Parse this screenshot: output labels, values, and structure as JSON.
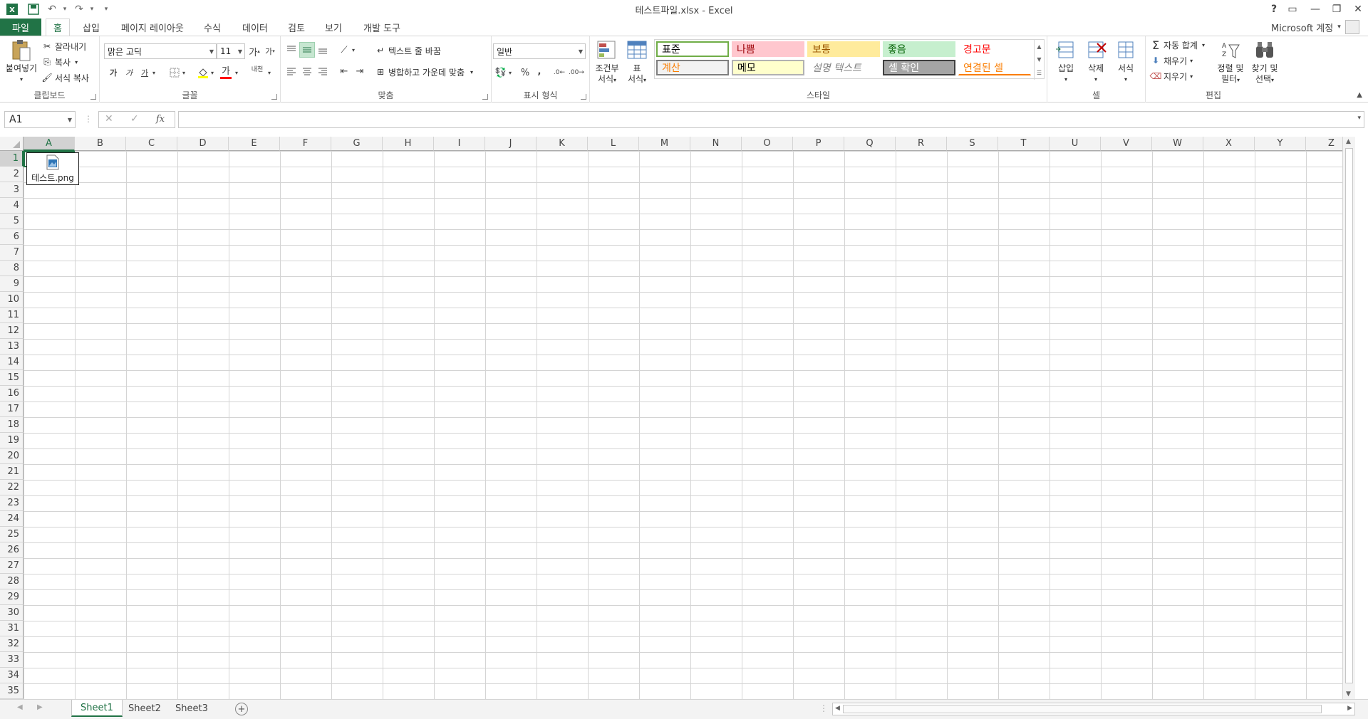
{
  "window": {
    "title": "테스트파일.xlsx - Excel",
    "help": "?",
    "account": "Microsoft 계정"
  },
  "tabs": [
    "파일",
    "홈",
    "삽입",
    "페이지 레이아웃",
    "수식",
    "데이터",
    "검토",
    "보기",
    "개발 도구"
  ],
  "active_tab": "홈",
  "ribbon": {
    "clipboard": {
      "paste": "붙여넣기",
      "cut": "잘라내기",
      "copy": "복사",
      "format_painter": "서식 복사",
      "label": "클립보드"
    },
    "font": {
      "font_name": "맑은 고딕",
      "font_size": "11",
      "grow": "가",
      "shrink": "가",
      "bold": "가",
      "italic": "가",
      "underline": "가",
      "font_color": "가",
      "phonetic": "내천",
      "label": "글꼴"
    },
    "alignment": {
      "wrap_text": "텍스트 줄 바꿈",
      "merge_center": "병합하고 가운데 맞춤",
      "label": "맞춤"
    },
    "number": {
      "format": "일반",
      "percent": "%",
      "comma": ",",
      "label": "표시 형식"
    },
    "styles": {
      "conditional": [
        "조건부",
        "서식"
      ],
      "format_table": [
        "표",
        "서식"
      ],
      "cells": [
        {
          "text": "표준",
          "bg": "#ffffff",
          "fg": "#000000",
          "border": "#70ad47"
        },
        {
          "text": "나쁨",
          "bg": "#ffc7ce",
          "fg": "#9c0006",
          "border": ""
        },
        {
          "text": "보통",
          "bg": "#ffeb9c",
          "fg": "#9c5700",
          "border": ""
        },
        {
          "text": "좋음",
          "bg": "#c6efce",
          "fg": "#006100",
          "border": ""
        },
        {
          "text": "경고문",
          "bg": "#ffffff",
          "fg": "#ff0000",
          "border": ""
        },
        {
          "text": "계산",
          "bg": "#f2f2f2",
          "fg": "#fa7d00",
          "border": "#7f7f7f"
        },
        {
          "text": "메모",
          "bg": "#ffffcc",
          "fg": "#000000",
          "border": "#b2b2b2"
        },
        {
          "text": "설명 텍스트",
          "bg": "#ffffff",
          "fg": "#7f7f7f",
          "border": ""
        },
        {
          "text": "셀 확인",
          "bg": "#a5a5a5",
          "fg": "#ffffff",
          "border": "#3f3f3f"
        },
        {
          "text": "연결된 셀",
          "bg": "#ffffff",
          "fg": "#fa7d00",
          "border": ""
        }
      ],
      "label": "스타일"
    },
    "cells": {
      "insert": "삽입",
      "delete": "삭제",
      "format": "서식",
      "label": "셀"
    },
    "editing": {
      "autosum": "자동 합계",
      "fill": "채우기",
      "clear": "지우기",
      "sort_filter": [
        "정렬 및",
        "필터"
      ],
      "find_select": [
        "찾기 및",
        "선택"
      ],
      "label": "편집"
    }
  },
  "formula_bar": {
    "name_box": "A1",
    "fx": "fx",
    "value": ""
  },
  "grid": {
    "columns": [
      "A",
      "B",
      "C",
      "D",
      "E",
      "F",
      "G",
      "H",
      "I",
      "J",
      "K",
      "L",
      "M",
      "N",
      "O",
      "P",
      "Q",
      "R",
      "S",
      "T",
      "U",
      "V",
      "W",
      "X",
      "Y",
      "Z"
    ],
    "selected_column": "A",
    "selected_row": 1,
    "row_count": 35,
    "embedded_object": {
      "icon": "image-file-icon",
      "label": "테스트.png"
    }
  },
  "sheets": [
    "Sheet1",
    "Sheet2",
    "Sheet3"
  ],
  "active_sheet": "Sheet1",
  "colors": {
    "accent": "#217346",
    "grid_line": "#d4d4d4",
    "header_bg": "#f3f3f3"
  }
}
